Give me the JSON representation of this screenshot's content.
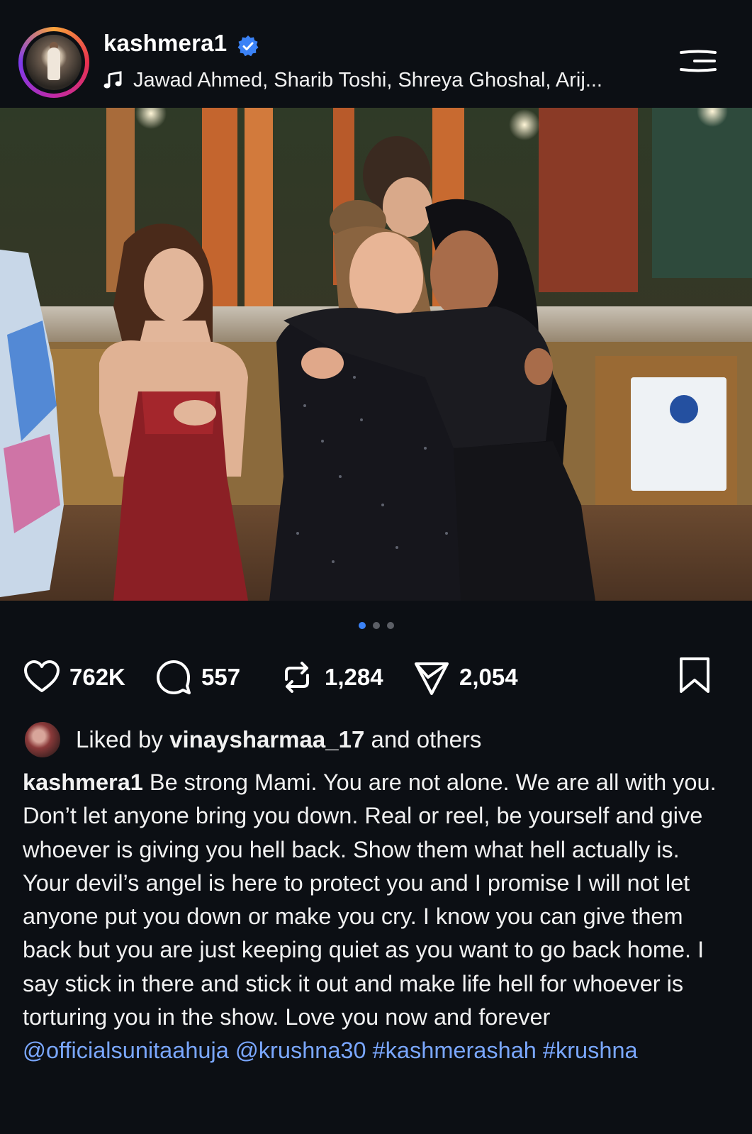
{
  "post": {
    "username": "kashmera1",
    "verified": true,
    "music": "Jawad Ahmed, Sharib Toshi, Shreya Ghoshal, Arij..."
  },
  "carousel": {
    "total": 3,
    "active": 1
  },
  "actions": {
    "likes": "762K",
    "comments": "557",
    "reposts": "1,284",
    "shares": "2,054"
  },
  "liked_by": {
    "prefix": "Liked by",
    "user": "vinaysharmaa_17",
    "suffix": "and others"
  },
  "caption": {
    "username": "kashmera1",
    "text": "Be strong Mami. You are not alone. We are all with you. Don’t let anyone bring you down. Real or reel, be yourself and give whoever is giving you hell back. Show them what hell actually is. Your devil’s angel is here to protect you and I promise I will not let anyone put you down or make you cry. I know you can give them back but you are just keeping quiet as you want to go back home. I say stick in there and stick it out and make life hell for whoever is torturing you in the show.  Love you now and forever",
    "tags": [
      "@officialsunitaahuja",
      "@krushna30",
      "#kashmerashah",
      "#krushna"
    ]
  },
  "colors": {
    "background": "#0c0f14",
    "accent": "#3b82f6",
    "tag": "#7aa7ff"
  }
}
